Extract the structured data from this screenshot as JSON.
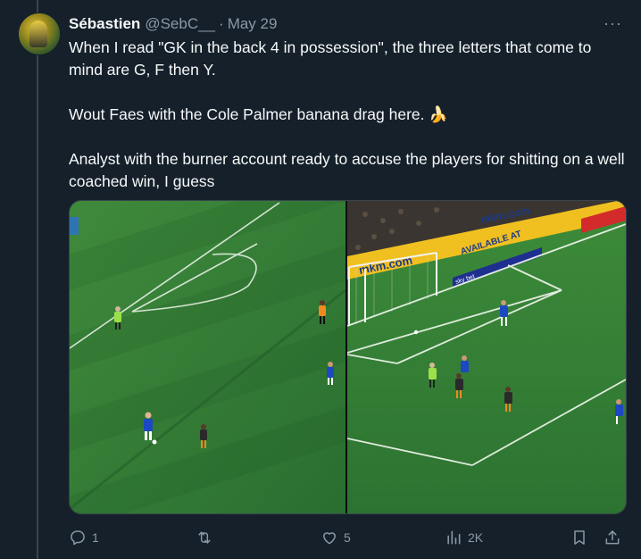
{
  "tweet": {
    "author_name": "Sébastien",
    "author_handle": "@SebC__",
    "separator": "·",
    "date": "May 29",
    "more_icon": "more-icon",
    "paragraphs": [
      "When I read \"GK in the back 4 in possession\", the three letters that come to mind are G, F then Y.",
      "Wout Faes with the Cole Palmer banana drag here. 🍌",
      "Analyst with the burner account ready to accuse the players for shitting on a well coached win, I guess"
    ]
  },
  "media": {
    "pitch_color": "#2f7a36",
    "stadium_ads": [
      "mkm.com",
      "AVAILABLE AT",
      "sky bet",
      "THE UK'S NO.1 BETTING APP"
    ]
  },
  "actions": {
    "reply": {
      "icon": "reply-icon",
      "count": "1"
    },
    "retweet": {
      "icon": "retweet-icon",
      "count": ""
    },
    "like": {
      "icon": "like-icon",
      "count": "5"
    },
    "views": {
      "icon": "views-icon",
      "count": "2K"
    },
    "bookmark": {
      "icon": "bookmark-icon"
    },
    "share": {
      "icon": "share-icon"
    }
  },
  "colors": {
    "background": "#15202b",
    "text": "#f7f9f9",
    "secondary": "#8b98a5",
    "border": "#38444d"
  }
}
